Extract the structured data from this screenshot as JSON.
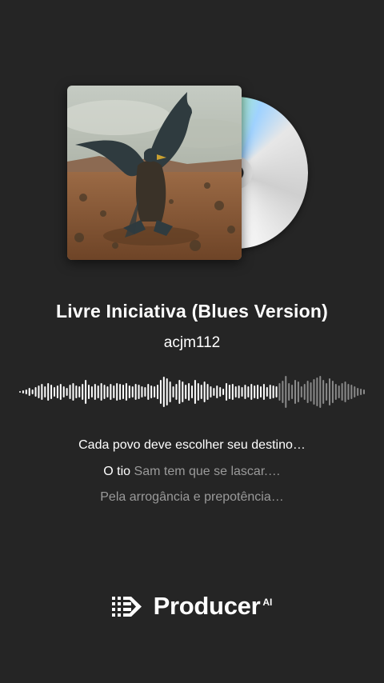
{
  "track": {
    "title": "Livre Iniciativa (Blues Version)",
    "artist": "acjm112"
  },
  "player": {
    "progress": 0.74
  },
  "lyrics": {
    "line1": "Cada povo deve escolher seu destino…",
    "line2_sung": "O tio",
    "line2_rest": " Sam tem que se lascar.…",
    "line3": "Pela arrogância e prepotência…"
  },
  "brand": {
    "name": "Producer",
    "suffix": "AI"
  },
  "colors": {
    "background": "#252525",
    "played": "#ffffff",
    "unplayed": "#8a8a8a"
  }
}
